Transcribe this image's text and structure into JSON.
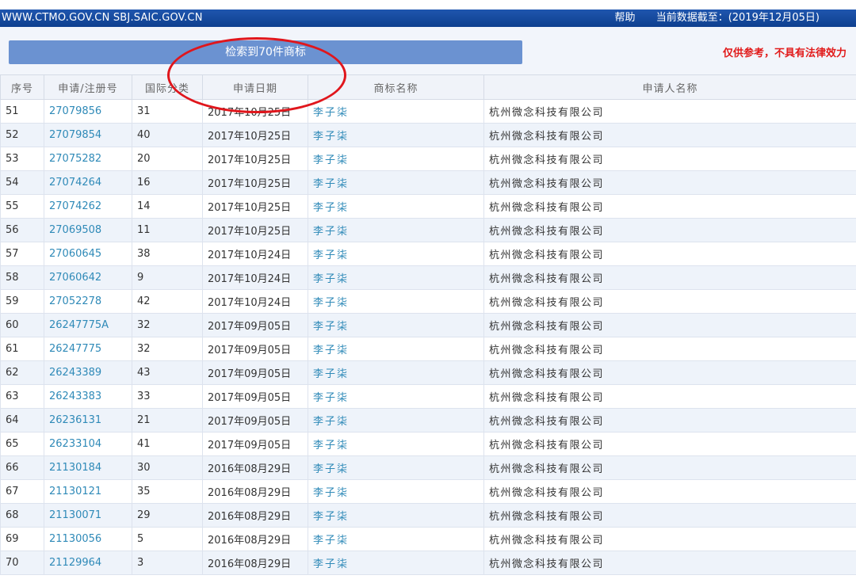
{
  "header": {
    "site": "WWW.CTMO.GOV.CN SBJ.SAIC.GOV.CN",
    "help": "帮助",
    "data_date": "当前数据截至：(2019年12月05日)"
  },
  "result": {
    "summary": "检索到70件商标",
    "disclaimer": "仅供参考，不具有法律效力"
  },
  "annotation": {
    "color": "#e0161c"
  },
  "table": {
    "columns": [
      "序号",
      "申请/注册号",
      "国际分类",
      "申请日期",
      "商标名称",
      "申请人名称"
    ],
    "rows": [
      {
        "no": "51",
        "reg": "27079856",
        "cls": "31",
        "date": "2017年10月25日",
        "mark": "李子柒",
        "applicant": "杭州微念科技有限公司"
      },
      {
        "no": "52",
        "reg": "27079854",
        "cls": "40",
        "date": "2017年10月25日",
        "mark": "李子柒",
        "applicant": "杭州微念科技有限公司"
      },
      {
        "no": "53",
        "reg": "27075282",
        "cls": "20",
        "date": "2017年10月25日",
        "mark": "李子柒",
        "applicant": "杭州微念科技有限公司"
      },
      {
        "no": "54",
        "reg": "27074264",
        "cls": "16",
        "date": "2017年10月25日",
        "mark": "李子柒",
        "applicant": "杭州微念科技有限公司"
      },
      {
        "no": "55",
        "reg": "27074262",
        "cls": "14",
        "date": "2017年10月25日",
        "mark": "李子柒",
        "applicant": "杭州微念科技有限公司"
      },
      {
        "no": "56",
        "reg": "27069508",
        "cls": "11",
        "date": "2017年10月25日",
        "mark": "李子柒",
        "applicant": "杭州微念科技有限公司"
      },
      {
        "no": "57",
        "reg": "27060645",
        "cls": "38",
        "date": "2017年10月24日",
        "mark": "李子柒",
        "applicant": "杭州微念科技有限公司"
      },
      {
        "no": "58",
        "reg": "27060642",
        "cls": "9",
        "date": "2017年10月24日",
        "mark": "李子柒",
        "applicant": "杭州微念科技有限公司"
      },
      {
        "no": "59",
        "reg": "27052278",
        "cls": "42",
        "date": "2017年10月24日",
        "mark": "李子柒",
        "applicant": "杭州微念科技有限公司"
      },
      {
        "no": "60",
        "reg": "26247775A",
        "cls": "32",
        "date": "2017年09月05日",
        "mark": "李子柒",
        "applicant": "杭州微念科技有限公司"
      },
      {
        "no": "61",
        "reg": "26247775",
        "cls": "32",
        "date": "2017年09月05日",
        "mark": "李子柒",
        "applicant": "杭州微念科技有限公司"
      },
      {
        "no": "62",
        "reg": "26243389",
        "cls": "43",
        "date": "2017年09月05日",
        "mark": "李子柒",
        "applicant": "杭州微念科技有限公司"
      },
      {
        "no": "63",
        "reg": "26243383",
        "cls": "33",
        "date": "2017年09月05日",
        "mark": "李子柒",
        "applicant": "杭州微念科技有限公司"
      },
      {
        "no": "64",
        "reg": "26236131",
        "cls": "21",
        "date": "2017年09月05日",
        "mark": "李子柒",
        "applicant": "杭州微念科技有限公司"
      },
      {
        "no": "65",
        "reg": "26233104",
        "cls": "41",
        "date": "2017年09月05日",
        "mark": "李子柒",
        "applicant": "杭州微念科技有限公司"
      },
      {
        "no": "66",
        "reg": "21130184",
        "cls": "30",
        "date": "2016年08月29日",
        "mark": "李子柒",
        "applicant": "杭州微念科技有限公司"
      },
      {
        "no": "67",
        "reg": "21130121",
        "cls": "35",
        "date": "2016年08月29日",
        "mark": "李子柒",
        "applicant": "杭州微念科技有限公司"
      },
      {
        "no": "68",
        "reg": "21130071",
        "cls": "29",
        "date": "2016年08月29日",
        "mark": "李子柒",
        "applicant": "杭州微念科技有限公司"
      },
      {
        "no": "69",
        "reg": "21130056",
        "cls": "5",
        "date": "2016年08月29日",
        "mark": "李子柒",
        "applicant": "杭州微念科技有限公司"
      },
      {
        "no": "70",
        "reg": "21129964",
        "cls": "3",
        "date": "2016年08月29日",
        "mark": "李子柒",
        "applicant": "杭州微念科技有限公司"
      }
    ]
  }
}
